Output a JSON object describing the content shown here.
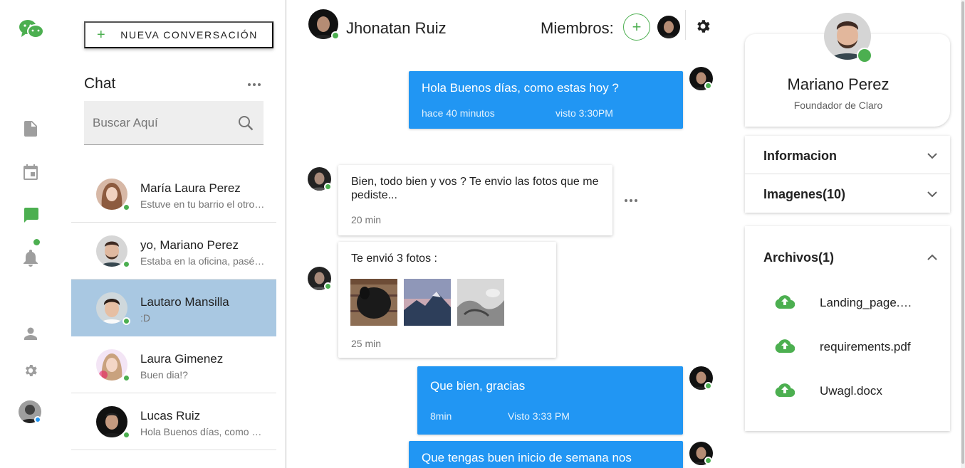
{
  "rail": {
    "icons": [
      "wechat-logo",
      "document-icon",
      "calendar-icon",
      "chat-icon",
      "bell-icon",
      "user-icon",
      "settings-icon",
      "avatar"
    ]
  },
  "sidebar": {
    "new_button": "NUEVA CONVERSACIÓN",
    "title": "Chat",
    "search_placeholder": "Buscar Aquí",
    "contacts": [
      {
        "name": "María Laura Perez",
        "preview": "Estuve en tu barrio el otro día"
      },
      {
        "name": "yo, Mariano Perez",
        "preview": "Estaba en la oficina, pasé por tu casa"
      },
      {
        "name": "Lautaro Mansilla",
        "preview": ":D"
      },
      {
        "name": "Laura Gimenez",
        "preview": "Buen dia!?"
      },
      {
        "name": "Lucas Ruiz",
        "preview": "Hola Buenos días, como estas hoy ?"
      }
    ]
  },
  "conversation": {
    "contact_name": "Jhonatan Ruiz",
    "members_label": "Miembros:",
    "add_member": "+",
    "messages": [
      {
        "text": "Hola Buenos días, como estas hoy ?",
        "time": "hace 40 minutos",
        "seen": "visto 3:30PM"
      },
      {
        "text": "Bien, todo bien y vos ? Te envio las fotos que me pediste...",
        "time": "20 min"
      },
      {
        "text": "Te envió 3 fotos :",
        "time": "25 min"
      },
      {
        "text": "Que bien, gracias",
        "time": "8min",
        "seen": "Visto 3:33 PM"
      },
      {
        "text": "Que tengas buen inicio de semana nos vemos!!"
      }
    ]
  },
  "profile": {
    "name": "Mariano Perez",
    "role": "Foundador de Claro",
    "sections": [
      {
        "label": "Informacion",
        "expanded": false
      },
      {
        "label": "Imagenes(10)",
        "expanded": false
      },
      {
        "label": "Archivos(1)",
        "expanded": true
      }
    ],
    "files": [
      "Landing_page.psd",
      "requirements.pdf",
      "Uwagl.docx"
    ]
  },
  "colors": {
    "accent_green": "#4caf50",
    "bubble_blue": "#2196f3",
    "active_contact": "#a9c8e2"
  }
}
